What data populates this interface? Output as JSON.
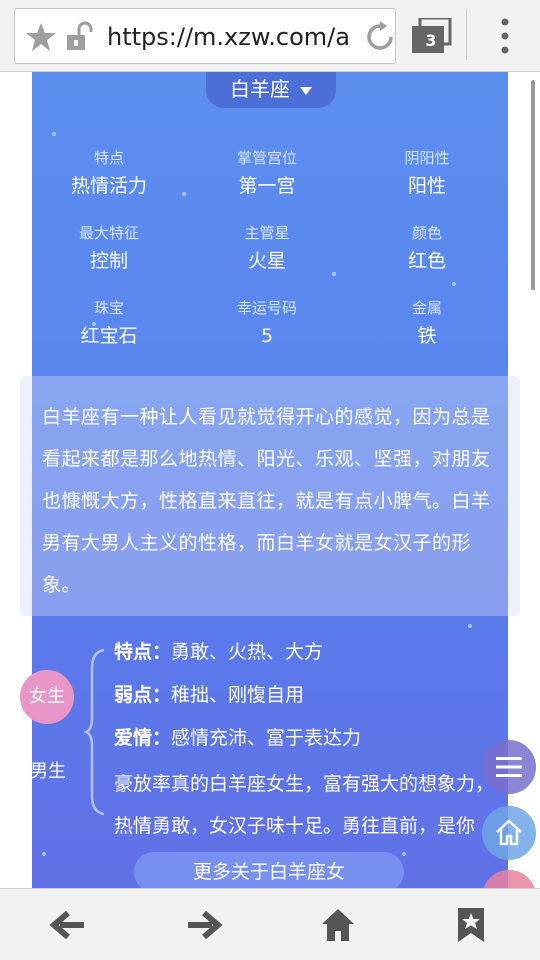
{
  "browser": {
    "url": "https://m.xzw.com/a",
    "tab_count": "3"
  },
  "sign": {
    "name": "白羊座"
  },
  "attributes": [
    {
      "key": "特点",
      "value": "热情活力"
    },
    {
      "key": "掌管宫位",
      "value": "第一宫"
    },
    {
      "key": "阴阳性",
      "value": "阳性"
    },
    {
      "key": "最大特征",
      "value": "控制"
    },
    {
      "key": "主管星",
      "value": "火星"
    },
    {
      "key": "颜色",
      "value": "红色"
    },
    {
      "key": "珠宝",
      "value": "红宝石"
    },
    {
      "key": "幸运号码",
      "value": "5"
    },
    {
      "key": "金属",
      "value": "铁"
    }
  ],
  "description": "白羊座有一种让人看见就觉得开心的感觉，因为总是看起来都是那么地热情、阳光、乐观、坚强，对朋友也慷慨大方，性格直来直往，就是有点小脾气。白羊男有大男人主义的性格，而白羊女就是女汉子的形象。",
  "gender_tabs": {
    "female": "女生",
    "male": "男生"
  },
  "female": {
    "traits": [
      {
        "label": "特点：",
        "text": "勇敢、火热、大方"
      },
      {
        "label": "弱点：",
        "text": "稚拙、刚愎自用"
      },
      {
        "label": "爱情：",
        "text": "感情充沛、富于表达力"
      }
    ],
    "desc": "豪放率真的白羊座女生，富有强大的想象力，热情勇敢，女汉子味十足。勇往直前，是你",
    "more": "更多关于白羊座女"
  },
  "icons": {
    "fab_menu": "menu-icon",
    "fab_home": "home-icon",
    "fab_top": "chevron-up-icon",
    "back": "arrow-left-icon",
    "forward": "arrow-right-icon",
    "home": "home-icon",
    "bookmark": "bookmark-icon"
  }
}
